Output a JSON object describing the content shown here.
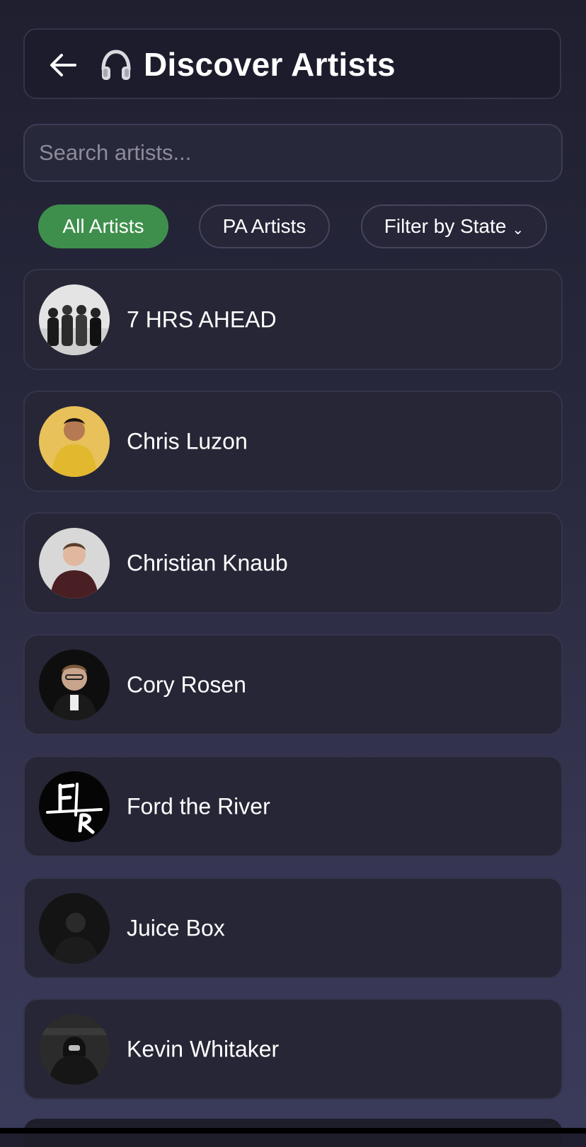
{
  "header": {
    "back_icon": "arrow-left-icon",
    "title_icon": "headphones-icon",
    "title": "Discover Artists"
  },
  "search": {
    "placeholder": "Search artists...",
    "value": ""
  },
  "filters": {
    "all_label": "All Artists",
    "pa_label": "PA Artists",
    "state_label": "Filter by State",
    "state_icon": "chevron-down-icon",
    "active": "All Artists",
    "active_color": "#3f8f4c"
  },
  "artists": [
    {
      "name": "7 HRS AHEAD"
    },
    {
      "name": "Chris Luzon"
    },
    {
      "name": "Christian Knaub"
    },
    {
      "name": "Cory Rosen"
    },
    {
      "name": "Ford the River",
      "logo_text": "F R"
    },
    {
      "name": "Juice Box"
    },
    {
      "name": "Kevin Whitaker"
    }
  ]
}
